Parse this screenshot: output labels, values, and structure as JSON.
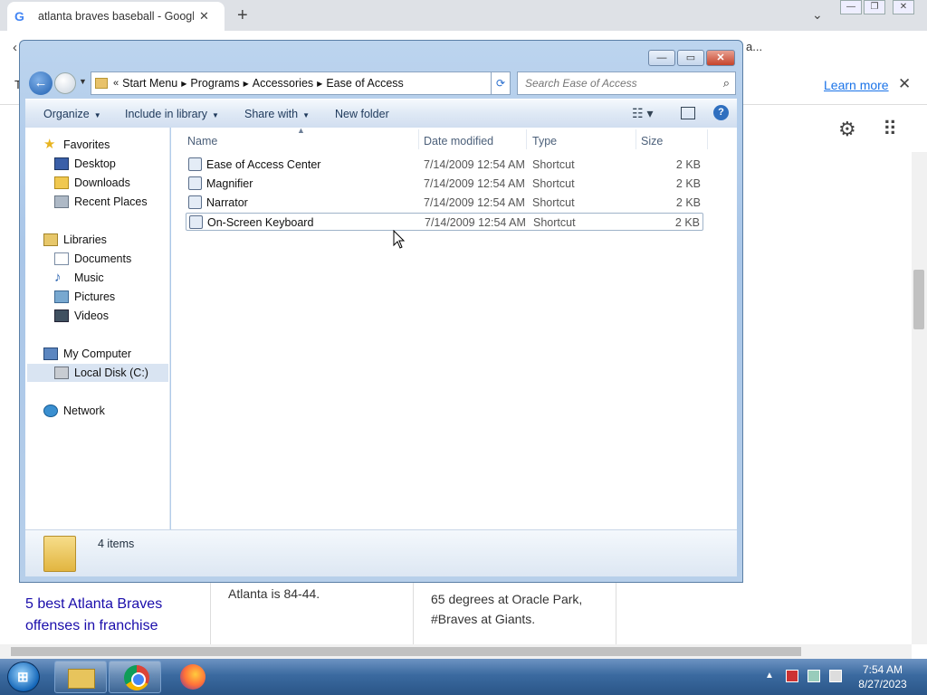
{
  "browser": {
    "tab_title": "atlanta braves baseball - Google",
    "tab_close": "✕",
    "new_tab": "+",
    "learn_more": "Learn more",
    "info_close": "✕",
    "addr_fragment": "a...",
    "results": {
      "link": "5 best Atlanta Braves offenses in franchise",
      "text1": "Atlanta is 84-44.",
      "text2": "65 degrees at Oracle Park, #Braves at Giants."
    }
  },
  "explorer": {
    "breadcrumb": [
      "Start Menu",
      "Programs",
      "Accessories",
      "Ease of Access"
    ],
    "breadcrumb_prefix": "«",
    "search_placeholder": "Search Ease of Access",
    "toolbar": {
      "organize": "Organize",
      "include_in_library": "Include in library",
      "share_with": "Share with",
      "new_folder": "New folder"
    },
    "nav": {
      "favorites": "Favorites",
      "desktop": "Desktop",
      "downloads": "Downloads",
      "recent_places": "Recent Places",
      "libraries": "Libraries",
      "documents": "Documents",
      "music": "Music",
      "pictures": "Pictures",
      "videos": "Videos",
      "my_computer": "My Computer",
      "local_disk": "Local Disk (C:)",
      "network": "Network"
    },
    "columns": {
      "name": "Name",
      "date": "Date modified",
      "type": "Type",
      "size": "Size"
    },
    "files": [
      {
        "name": "Ease of Access Center",
        "date": "7/14/2009 12:54 AM",
        "type": "Shortcut",
        "size": "2 KB"
      },
      {
        "name": "Magnifier",
        "date": "7/14/2009 12:54 AM",
        "type": "Shortcut",
        "size": "2 KB"
      },
      {
        "name": "Narrator",
        "date": "7/14/2009 12:54 AM",
        "type": "Shortcut",
        "size": "2 KB"
      },
      {
        "name": "On-Screen Keyboard",
        "date": "7/14/2009 12:54 AM",
        "type": "Shortcut",
        "size": "2 KB"
      }
    ],
    "status": "4 items"
  },
  "taskbar": {
    "time": "7:54 AM",
    "date": "8/27/2023"
  },
  "icons": [
    "google-icon",
    "star-icon",
    "gear-icon",
    "apps-grid-icon",
    "search-icon",
    "help-icon",
    "folder-icon",
    "shortcut-icon",
    "chrome-icon",
    "firefox-icon",
    "start-orb-icon"
  ]
}
